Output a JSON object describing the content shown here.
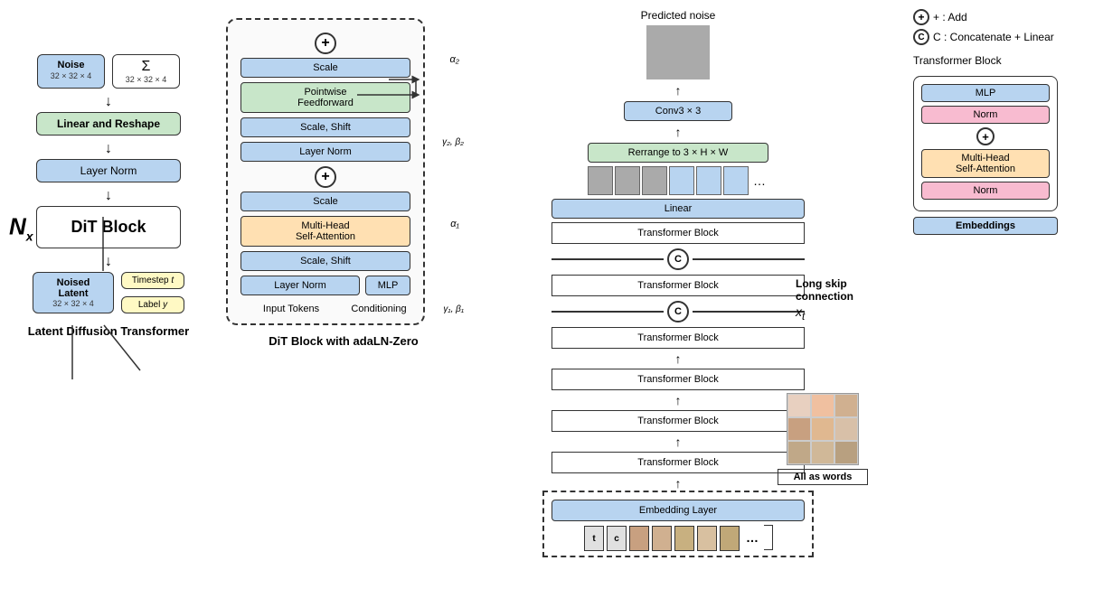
{
  "left": {
    "title": "Latent Diffusion Transformer",
    "noise_label": "Noise",
    "noise_size": "32 × 32 × 4",
    "sigma_symbol": "Σ",
    "sigma_size": "32 × 32 × 4",
    "linear_reshape": "Linear and Reshape",
    "layer_norm": "Layer Norm",
    "dit_block": "DiT Block",
    "nx_label": "N",
    "nx_sub": "x",
    "noised_latent": "Noised\nLatent",
    "noised_latent_size": "32 × 32 × 4",
    "timestep_label": "Timestep t",
    "label_label": "Label y"
  },
  "middle": {
    "title": "DiT Block with adaLN-Zero",
    "scale_top": "Scale",
    "pointwise_ff": "Pointwise\nFeedforward",
    "scale_shift_2": "Scale, Shift",
    "layer_norm_2": "Layer Norm",
    "scale_1": "Scale",
    "multi_head_attn": "Multi-Head\nSelf-Attention",
    "scale_shift_1": "Scale, Shift",
    "layer_norm_1": "Layer Norm",
    "mlp": "MLP",
    "input_tokens": "Input Tokens",
    "conditioning": "Conditioning",
    "alpha2_label": "α₂",
    "alpha1_label": "α₁",
    "gamma2_beta2": "γ₂, β₂",
    "gamma1_beta1": "γ₁, β₁"
  },
  "right": {
    "predicted_noise": "Predicted noise",
    "conv3x3": "Conv3 × 3",
    "rerrange": "Rerrange to 3 × H × W",
    "linear": "Linear",
    "transformer_blocks": [
      "Transformer Block",
      "Transformer Block",
      "Transformer Block",
      "Transformer Block",
      "Transformer Block",
      "Transformer Block"
    ],
    "embedding_layer": "Embedding Layer",
    "long_skip": "Long skip connection",
    "xt_label": "x_t",
    "all_as_words": "All as words"
  },
  "legend": {
    "add_label": "+ : Add",
    "concat_label": "C : Concatenate + Linear",
    "transformer_block_title": "Transformer Block",
    "mlp": "MLP",
    "norm": "Norm",
    "multi_head": "Multi-Head\nSelf-Attention",
    "norm2": "Norm",
    "embeddings": "Embeddings"
  },
  "icons": {
    "add": "+",
    "concat": "C"
  }
}
